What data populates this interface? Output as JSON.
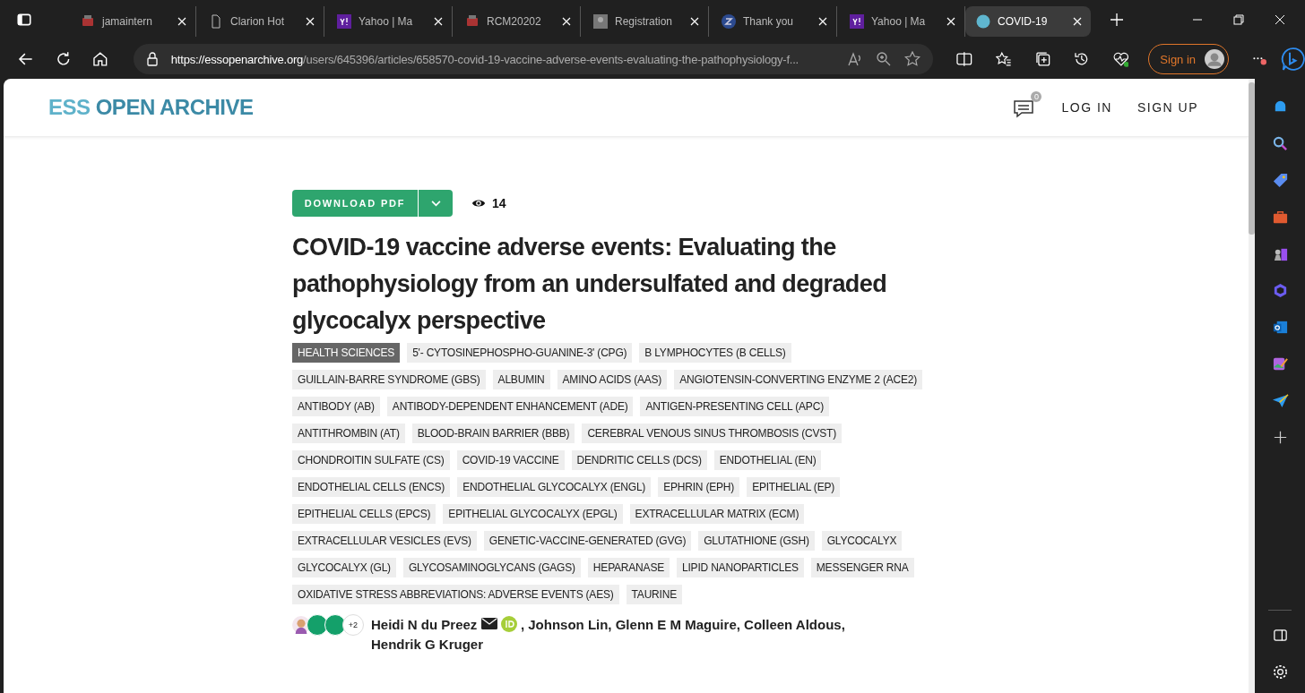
{
  "browser": {
    "tabs": [
      {
        "title": "jamaintern",
        "kind": "pdf",
        "selected": false
      },
      {
        "title": "Clarion Hot",
        "kind": "page",
        "selected": false
      },
      {
        "title": "Yahoo | Ma",
        "kind": "yahoo",
        "selected": false
      },
      {
        "title": "RCM20202",
        "kind": "pdf",
        "selected": false
      },
      {
        "title": "Registration",
        "kind": "gray",
        "selected": false
      },
      {
        "title": "Thank you",
        "kind": "z",
        "selected": false
      },
      {
        "title": "Yahoo | Ma",
        "kind": "yahoo",
        "selected": false
      },
      {
        "title": "COVID-19",
        "kind": "globe",
        "selected": true
      }
    ],
    "url_host": "https://essopenarchive.org",
    "url_path": "/users/645396/articles/658570-covid-19-vaccine-adverse-events-evaluating-the-pathophysiology-f...",
    "sign_in": "Sign in"
  },
  "site": {
    "logo_light": "ESS",
    "logo_dark": "OPEN ARCHIVE",
    "comments_count": "0",
    "log_in": "LOG IN",
    "sign_up": "SIGN UP"
  },
  "article": {
    "download": "DOWNLOAD PDF",
    "views": "14",
    "title": "COVID-19 vaccine adverse events: Evaluating the pathophysiology from an undersulfated and degraded glycocalyx perspective",
    "tags": [
      {
        "label": "HEALTH SCIENCES",
        "kind": "subject"
      },
      {
        "label": "5'- CYTOSINEPHOSPHO-GUANINE-3' (CPG)",
        "kind": "keyword"
      },
      {
        "label": "B LYMPHOCYTES (B CELLS)",
        "kind": "keyword"
      },
      {
        "label": "GUILLAIN-BARRE SYNDROME (GBS)",
        "kind": "keyword"
      },
      {
        "label": "ALBUMIN",
        "kind": "keyword"
      },
      {
        "label": "AMINO ACIDS (AAS)",
        "kind": "keyword"
      },
      {
        "label": "ANGIOTENSIN-CONVERTING ENZYME 2 (ACE2)",
        "kind": "keyword"
      },
      {
        "label": "ANTIBODY (AB)",
        "kind": "keyword"
      },
      {
        "label": "ANTIBODY-DEPENDENT ENHANCEMENT (ADE)",
        "kind": "keyword"
      },
      {
        "label": "ANTIGEN-PRESENTING CELL (APC)",
        "kind": "keyword"
      },
      {
        "label": "ANTITHROMBIN (AT)",
        "kind": "keyword"
      },
      {
        "label": "BLOOD-BRAIN BARRIER (BBB)",
        "kind": "keyword"
      },
      {
        "label": "CEREBRAL VENOUS SINUS THROMBOSIS (CVST)",
        "kind": "keyword"
      },
      {
        "label": "CHONDROITIN SULFATE (CS)",
        "kind": "keyword"
      },
      {
        "label": "COVID-19 VACCINE",
        "kind": "keyword"
      },
      {
        "label": "DENDRITIC CELLS (DCS)",
        "kind": "keyword"
      },
      {
        "label": "ENDOTHELIAL (EN)",
        "kind": "keyword"
      },
      {
        "label": "ENDOTHELIAL CELLS (ENCS)",
        "kind": "keyword"
      },
      {
        "label": "ENDOTHELIAL GLYCOCALYX (ENGL)",
        "kind": "keyword"
      },
      {
        "label": "EPHRIN (EPH)",
        "kind": "keyword"
      },
      {
        "label": "EPITHELIAL (EP)",
        "kind": "keyword"
      },
      {
        "label": "EPITHELIAL CELLS (EPCS)",
        "kind": "keyword"
      },
      {
        "label": "EPITHELIAL GLYCOCALYX (EPGL)",
        "kind": "keyword"
      },
      {
        "label": "EXTRACELLULAR MATRIX (ECM)",
        "kind": "keyword"
      },
      {
        "label": "EXTRACELLULAR VESICLES (EVS)",
        "kind": "keyword"
      },
      {
        "label": "GENETIC-VACCINE-GENERATED (GVG)",
        "kind": "keyword"
      },
      {
        "label": "GLUTATHIONE (GSH)",
        "kind": "keyword"
      },
      {
        "label": "GLYCOCALYX",
        "kind": "keyword"
      },
      {
        "label": "GLYCOCALYX (GL)",
        "kind": "keyword"
      },
      {
        "label": "GLYCOSAMINOGLYCANS (GAGS)",
        "kind": "keyword"
      },
      {
        "label": "HEPARANASE",
        "kind": "keyword"
      },
      {
        "label": "LIPID NANOPARTICLES",
        "kind": "keyword"
      },
      {
        "label": "MESSENGER RNA",
        "kind": "keyword"
      },
      {
        "label": "OXIDATIVE STRESS ABBREVIATIONS: ADVERSE EVENTS (AES)",
        "kind": "keyword"
      },
      {
        "label": "TAURINE",
        "kind": "keyword"
      }
    ],
    "more_authors": "+2",
    "first_author": "Heidi N du Preez",
    "other_authors_line_1": ", Johnson Lin, Glenn E M Maguire, Colleen Aldous,",
    "other_authors_line_2": "Hendrik G Kruger"
  }
}
